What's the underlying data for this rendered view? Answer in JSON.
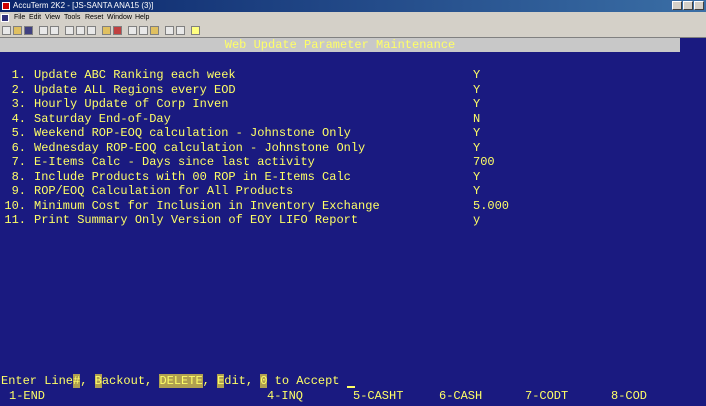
{
  "window": {
    "title": "AccuTerm 2K2 - [JS-SANTA ANA15 (3)]"
  },
  "menu": [
    "File",
    "Edit",
    "View",
    "Tools",
    "Reset",
    "Window",
    "Help"
  ],
  "toolbar": {
    "buttons": [
      "new-icon",
      "open-icon",
      "save-icon",
      "print-icon",
      "print-preview-icon",
      "copy-icon",
      "paste-icon",
      "find-icon",
      "send-icon",
      "receive-icon",
      "capture-icon",
      "settings-icon",
      "properties-icon",
      "macro-icon",
      "keyboard-icon",
      "help-icon"
    ]
  },
  "screen": {
    "header": "Web Update Parameter Maintenance",
    "items": [
      {
        "num": "1.",
        "label": "Update ABC Ranking each week",
        "value": "Y"
      },
      {
        "num": "2.",
        "label": "Update ALL Regions every EOD",
        "value": "Y"
      },
      {
        "num": "3.",
        "label": "Hourly Update of Corp Inven",
        "value": "Y"
      },
      {
        "num": "4.",
        "label": "Saturday End-of-Day",
        "value": "N"
      },
      {
        "num": "5.",
        "label": "Weekend ROP-EOQ calculation - Johnstone Only",
        "value": "Y"
      },
      {
        "num": "6.",
        "label": "Wednesday ROP-EOQ calculation - Johnstone Only",
        "value": "Y"
      },
      {
        "num": "7.",
        "label": "E-Items Calc - Days since last activity",
        "value": "700"
      },
      {
        "num": "8.",
        "label": "Include Products with 00 ROP in E-Items Calc",
        "value": "Y"
      },
      {
        "num": "9.",
        "label": "ROP/EOQ Calculation for All Products",
        "value": "Y"
      },
      {
        "num": "10.",
        "label": "Minimum Cost for Inclusion in Inventory Exchange",
        "value": "5.000"
      },
      {
        "num": "11.",
        "label": "Print Summary Only Version of EOY LIFO Report",
        "value": "y"
      }
    ],
    "prompt": {
      "p1": "Enter Line",
      "h1": "#",
      "p2": ", ",
      "h2": "B",
      "p3": "ackout, ",
      "h3": "DELETE",
      "p4": ", ",
      "h4": "E",
      "p5": "dit, ",
      "h5": "0",
      "p6": " to Accept "
    },
    "fkeys": [
      {
        "label": "1-END"
      },
      {
        "label": "4-INQ"
      },
      {
        "label": "5-CASHT"
      },
      {
        "label": "6-CASH"
      },
      {
        "label": "7-CODT"
      },
      {
        "label": "8-COD"
      }
    ]
  }
}
